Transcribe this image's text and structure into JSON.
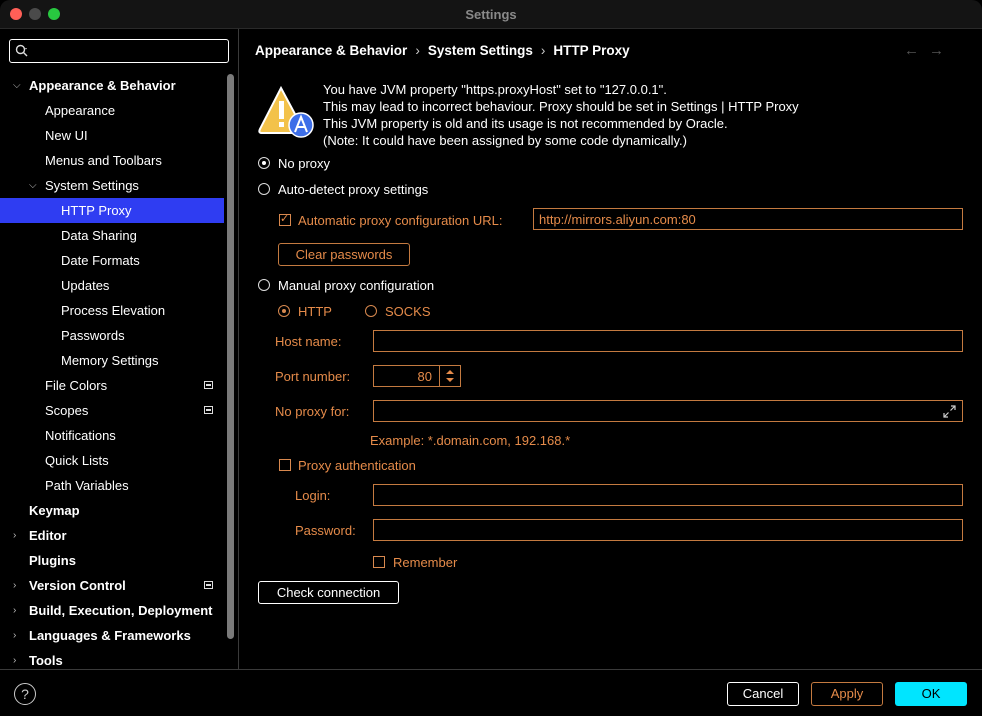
{
  "window": {
    "title": "Settings"
  },
  "sidebar": {
    "search_placeholder": "",
    "items": [
      {
        "label": "Appearance & Behavior"
      },
      {
        "label": "Appearance"
      },
      {
        "label": "New UI"
      },
      {
        "label": "Menus and Toolbars"
      },
      {
        "label": "System Settings"
      },
      {
        "label": "HTTP Proxy"
      },
      {
        "label": "Data Sharing"
      },
      {
        "label": "Date Formats"
      },
      {
        "label": "Updates"
      },
      {
        "label": "Process Elevation"
      },
      {
        "label": "Passwords"
      },
      {
        "label": "Memory Settings"
      },
      {
        "label": "File Colors"
      },
      {
        "label": "Scopes"
      },
      {
        "label": "Notifications"
      },
      {
        "label": "Quick Lists"
      },
      {
        "label": "Path Variables"
      },
      {
        "label": "Keymap"
      },
      {
        "label": "Editor"
      },
      {
        "label": "Plugins"
      },
      {
        "label": "Version Control"
      },
      {
        "label": "Build, Execution, Deployment"
      },
      {
        "label": "Languages & Frameworks"
      },
      {
        "label": "Tools"
      }
    ]
  },
  "breadcrumb": [
    "Appearance & Behavior",
    "System Settings",
    "HTTP Proxy"
  ],
  "warning": [
    "You have JVM property \"https.proxyHost\" set to \"127.0.0.1\".",
    "This may lead to incorrect behaviour. Proxy should be set in Settings | HTTP Proxy",
    "This JVM property is old and its usage is not recommended by Oracle.",
    "(Note: It could have been assigned by some code dynamically.)"
  ],
  "proxy": {
    "no_proxy": "No proxy",
    "auto_detect": "Auto-detect proxy settings",
    "auto_config_url_label": "Automatic proxy configuration URL:",
    "auto_config_url_value": "http://mirrors.aliyun.com:80",
    "clear_passwords": "Clear passwords",
    "manual": "Manual proxy configuration",
    "http": "HTTP",
    "socks": "SOCKS",
    "host_label": "Host name:",
    "host_value": "",
    "port_label": "Port number:",
    "port_value": "80",
    "no_proxy_for_label": "No proxy for:",
    "no_proxy_for_value": "",
    "example": "Example: *.domain.com, 192.168.*",
    "auth_label": "Proxy authentication",
    "login_label": "Login:",
    "login_value": "",
    "password_label": "Password:",
    "password_value": "",
    "remember": "Remember",
    "check_connection": "Check connection"
  },
  "footer": {
    "help": "?",
    "cancel": "Cancel",
    "apply": "Apply",
    "ok": "OK"
  },
  "colors": {
    "accent": "#2f3df2",
    "disabled_orange": "#e58b4a",
    "ok": "#00e5ff"
  }
}
